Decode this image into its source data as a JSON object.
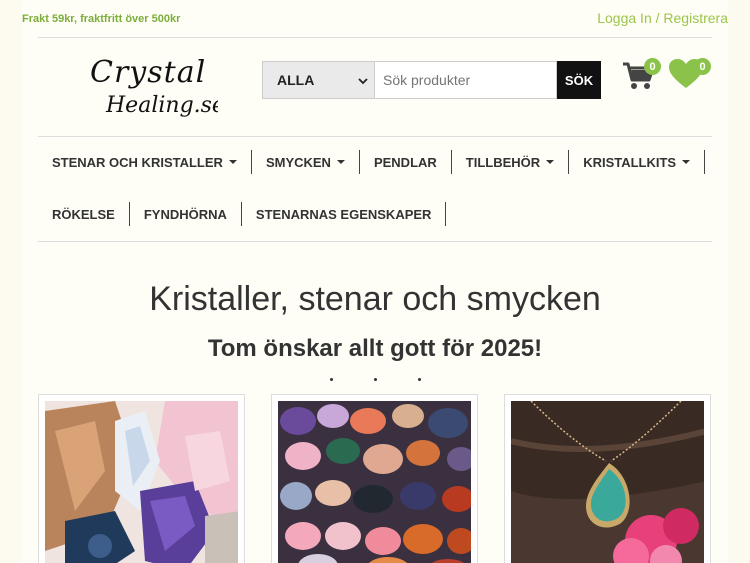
{
  "topbar": {
    "shipping": "Frakt 59kr, fraktfritt över 500kr",
    "login": "Logga In",
    "divider": " / ",
    "register": "Registrera"
  },
  "logo": {
    "line1": "Crystal",
    "line2": "Healing.se"
  },
  "search": {
    "category": "ALLA",
    "placeholder": "Sök produkter",
    "button": "SÖK"
  },
  "cart": {
    "count": "0"
  },
  "wishlist": {
    "count": "0"
  },
  "nav": {
    "row1": [
      {
        "label": "STENAR OCH KRISTALLER",
        "dropdown": true
      },
      {
        "label": "SMYCKEN",
        "dropdown": true
      },
      {
        "label": "PENDLAR",
        "dropdown": false
      },
      {
        "label": "TILLBEHÖR",
        "dropdown": true
      },
      {
        "label": "KRISTALLKITS",
        "dropdown": true
      }
    ],
    "row2": [
      {
        "label": "RÖKELSE",
        "dropdown": false
      },
      {
        "label": "FYNDHÖRNA",
        "dropdown": false
      },
      {
        "label": "STENARNAS EGENSKAPER",
        "dropdown": false
      }
    ]
  },
  "main": {
    "title": "Kristaller, stenar och smycken",
    "subtitle": "Tom önskar allt gott för 2025!"
  },
  "colors": {
    "accent": "#8bc34a",
    "background": "#fefdf6"
  }
}
